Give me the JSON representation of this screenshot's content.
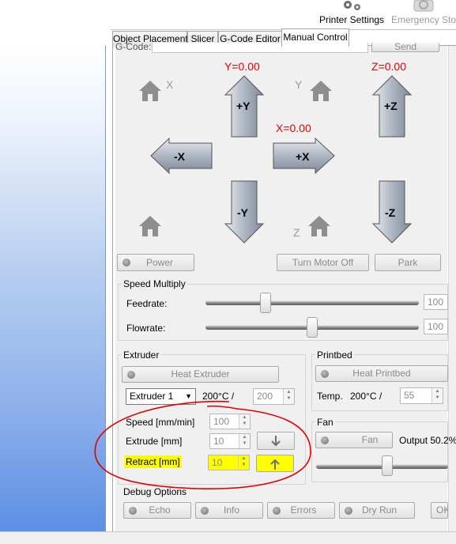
{
  "toolbar": {
    "printer_settings": "Printer Settings",
    "emergency_stop": "Emergency Stop"
  },
  "tabs": [
    {
      "label": "Object Placement"
    },
    {
      "label": "Slicer"
    },
    {
      "label": "G-Code Editor"
    },
    {
      "label": "Manual Control"
    }
  ],
  "gcode": {
    "label": "G-Code:",
    "send": "Send"
  },
  "jog": {
    "y_value": "Y=0.00",
    "x_value": "X=0.00",
    "z_value": "Z=0.00",
    "home_x": "X",
    "home_y": "Y",
    "home_z": "Z",
    "btn_py": "+Y",
    "btn_ny": "-Y",
    "btn_px": "+X",
    "btn_nx": "-X",
    "btn_pz": "+Z",
    "btn_nz": "-Z"
  },
  "controls": {
    "power": "Power",
    "turn_motor_off": "Turn Motor Off",
    "park": "Park"
  },
  "speed_multiply": {
    "title": "Speed Multiply",
    "feedrate_label": "Feedrate:",
    "feedrate_value": "100",
    "flowrate_label": "Flowrate:",
    "flowrate_value": "100",
    "feedrate_fraction": 0.28,
    "flowrate_fraction": 0.5
  },
  "extruder": {
    "title": "Extruder",
    "heat_button": "Heat Extruder",
    "select_value": "Extruder 1",
    "temp_current": "200°C /",
    "temp_target": "200",
    "speed_label": "Speed [mm/min]",
    "speed_value": "100",
    "extrude_label": "Extrude [mm]",
    "extrude_value": "10",
    "retract_label": "Retract [mm]",
    "retract_value": "10"
  },
  "printbed": {
    "title": "Printbed",
    "heat_button": "Heat Printbed",
    "temp_label": "Temp.",
    "temp_current": "200°C /",
    "temp_target": "55"
  },
  "fan": {
    "title": "Fan",
    "button": "Fan",
    "output_label": "Output 50.2%",
    "fraction": 0.502
  },
  "debug": {
    "title": "Debug Options",
    "echo": "Echo",
    "info": "Info",
    "errors": "Errors",
    "dry_run": "Dry Run",
    "ok": "OK"
  },
  "colors": {
    "axis_value": "#e00000",
    "highlight": "#ffff00",
    "annotation": "#e00000"
  }
}
